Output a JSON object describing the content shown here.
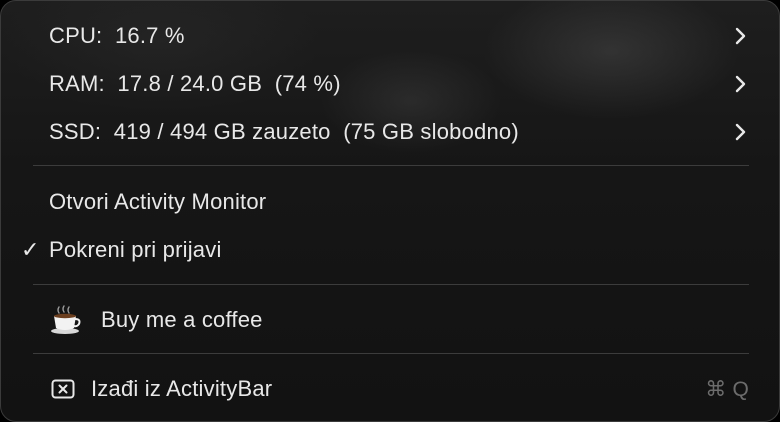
{
  "stats": {
    "cpu": "CPU:  16.7 %",
    "ram": "RAM:  17.8 / 24.0 GB  (74 %)",
    "ssd": "SSD:  419 / 494 GB zauzeto  (75 GB slobodno)"
  },
  "actions": {
    "open_monitor": "Otvori Activity Monitor",
    "launch_at_login_check": "✓",
    "launch_at_login": "Pokreni pri prijavi",
    "coffee": "Buy me a coffee",
    "quit": "Izađi iz ActivityBar",
    "quit_shortcut": "⌘ Q"
  },
  "icons": {
    "submenu": "chevron-right-icon",
    "coffee": "coffee-cup-icon",
    "quit": "close-box-icon"
  },
  "colors": {
    "text": "#e8e8e8",
    "shortcut": "#6c6c6c",
    "separator": "#3c3c3c"
  }
}
